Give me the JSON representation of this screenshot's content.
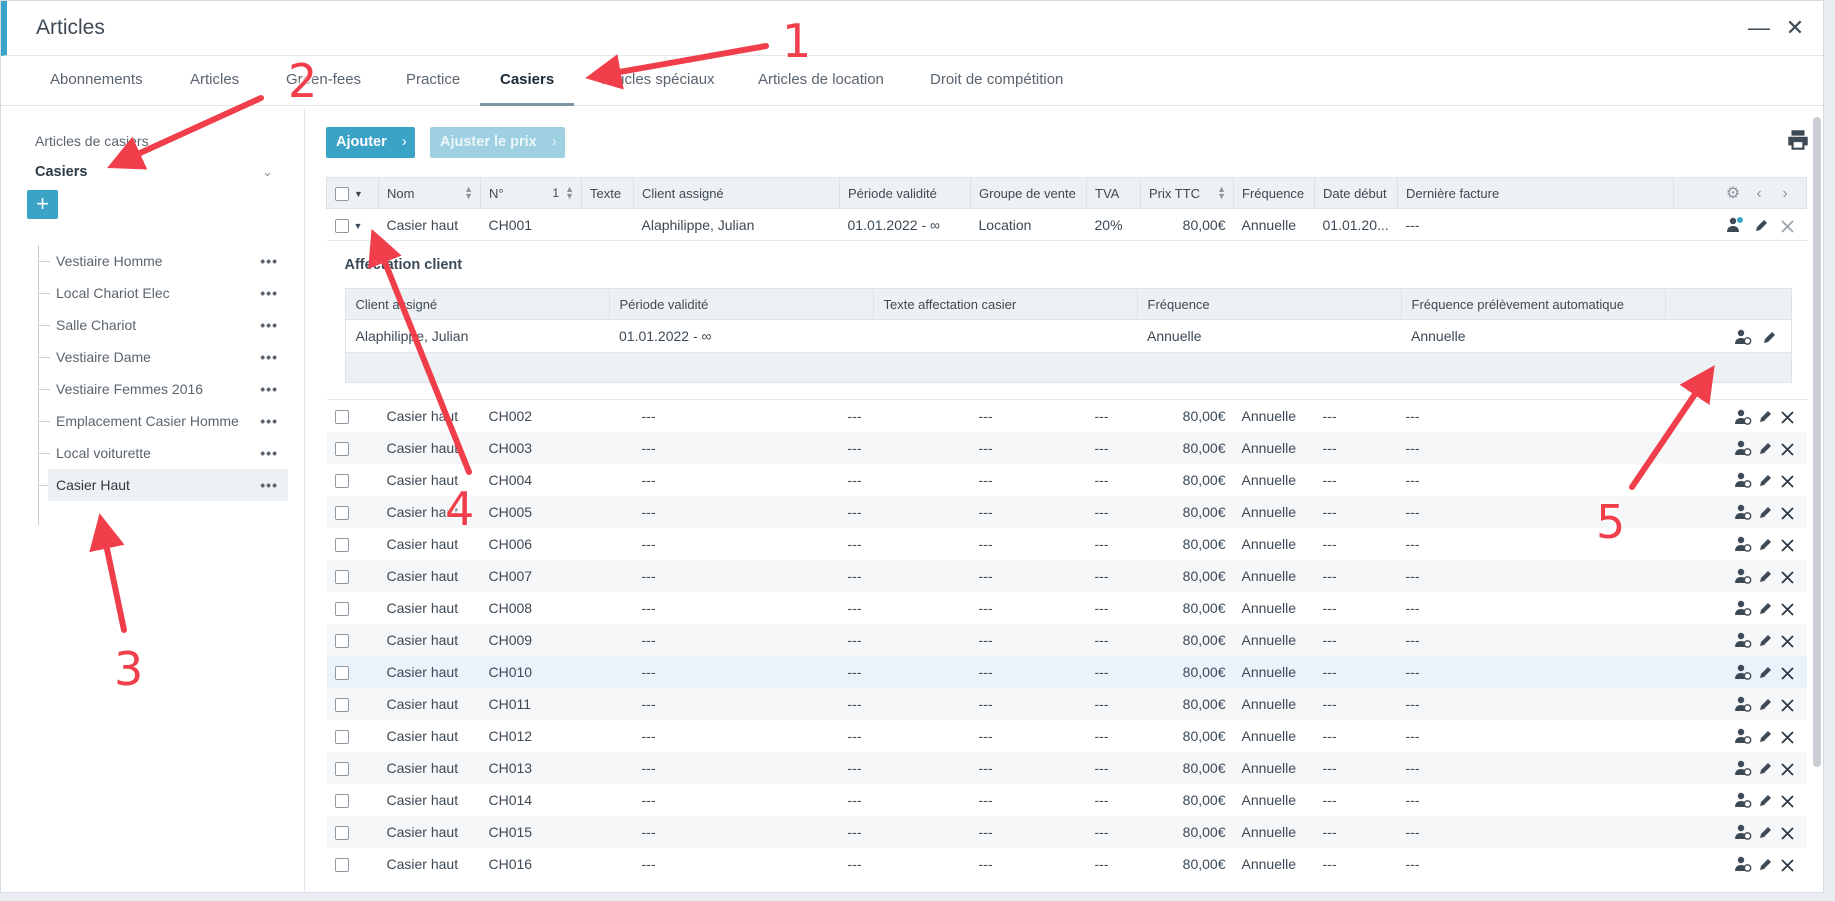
{
  "window": {
    "title": "Articles",
    "minimize_icon": "minimize-icon",
    "close_icon": "close-icon"
  },
  "tabs": [
    "Abonnements",
    "Articles",
    "Green-fees",
    "Practice",
    "Casiers",
    "Articles spéciaux",
    "Articles de location",
    "Droit de compétition"
  ],
  "active_tab": "Casiers",
  "sidebar": {
    "subtitle": "Articles de casiers",
    "heading": "Casiers",
    "add_label": "+",
    "items": [
      "Vestiaire Homme",
      "Local Chariot Elec",
      "Salle Chariot",
      "Vestiaire Dame",
      "Vestiaire Femmes 2016",
      "Emplacement Casier Homme",
      "Local voiturette",
      "Casier Haut"
    ],
    "selected": "Casier Haut",
    "more_label": "•••"
  },
  "toolbar": {
    "add_label": "Ajouter",
    "adjust_price_label": "Ajuster le prix",
    "chevron": "›"
  },
  "grid": {
    "columns": [
      "Nom",
      "N°",
      "Texte",
      "Client assigné",
      "Période validité",
      "Groupe de vente",
      "TVA",
      "Prix TTC",
      "Fréquence",
      "Date début",
      "Dernière facture"
    ],
    "sort_index": "1",
    "first_row": {
      "nom": "Casier haut",
      "no": "CH001",
      "texte": "",
      "client": "Alaphilippe, Julian",
      "periode": "01.01.2022 - ∞",
      "groupe": "Location",
      "tva": "20%",
      "prix": "80,00€",
      "frequence": "Annuelle",
      "debut": "01.01.20...",
      "derniere": "---"
    },
    "rows": [
      {
        "nom": "Casier haut",
        "no": "CH002",
        "client": "---",
        "periode": "---",
        "groupe": "---",
        "tva": "---",
        "prix": "80,00€",
        "frequence": "Annuelle",
        "debut": "---",
        "derniere": "---"
      },
      {
        "nom": "Casier haut",
        "no": "CH003",
        "client": "---",
        "periode": "---",
        "groupe": "---",
        "tva": "---",
        "prix": "80,00€",
        "frequence": "Annuelle",
        "debut": "---",
        "derniere": "---"
      },
      {
        "nom": "Casier haut",
        "no": "CH004",
        "client": "---",
        "periode": "---",
        "groupe": "---",
        "tva": "---",
        "prix": "80,00€",
        "frequence": "Annuelle",
        "debut": "---",
        "derniere": "---"
      },
      {
        "nom": "Casier haut",
        "no": "CH005",
        "client": "---",
        "periode": "---",
        "groupe": "---",
        "tva": "---",
        "prix": "80,00€",
        "frequence": "Annuelle",
        "debut": "---",
        "derniere": "---"
      },
      {
        "nom": "Casier haut",
        "no": "CH006",
        "client": "---",
        "periode": "---",
        "groupe": "---",
        "tva": "---",
        "prix": "80,00€",
        "frequence": "Annuelle",
        "debut": "---",
        "derniere": "---"
      },
      {
        "nom": "Casier haut",
        "no": "CH007",
        "client": "---",
        "periode": "---",
        "groupe": "---",
        "tva": "---",
        "prix": "80,00€",
        "frequence": "Annuelle",
        "debut": "---",
        "derniere": "---"
      },
      {
        "nom": "Casier haut",
        "no": "CH008",
        "client": "---",
        "periode": "---",
        "groupe": "---",
        "tva": "---",
        "prix": "80,00€",
        "frequence": "Annuelle",
        "debut": "---",
        "derniere": "---"
      },
      {
        "nom": "Casier haut",
        "no": "CH009",
        "client": "---",
        "periode": "---",
        "groupe": "---",
        "tva": "---",
        "prix": "80,00€",
        "frequence": "Annuelle",
        "debut": "---",
        "derniere": "---"
      },
      {
        "nom": "Casier haut",
        "no": "CH010",
        "client": "---",
        "periode": "---",
        "groupe": "---",
        "tva": "---",
        "prix": "80,00€",
        "frequence": "Annuelle",
        "debut": "---",
        "derniere": "---"
      },
      {
        "nom": "Casier haut",
        "no": "CH011",
        "client": "---",
        "periode": "---",
        "groupe": "---",
        "tva": "---",
        "prix": "80,00€",
        "frequence": "Annuelle",
        "debut": "---",
        "derniere": "---"
      },
      {
        "nom": "Casier haut",
        "no": "CH012",
        "client": "---",
        "periode": "---",
        "groupe": "---",
        "tva": "---",
        "prix": "80,00€",
        "frequence": "Annuelle",
        "debut": "---",
        "derniere": "---"
      },
      {
        "nom": "Casier haut",
        "no": "CH013",
        "client": "---",
        "periode": "---",
        "groupe": "---",
        "tva": "---",
        "prix": "80,00€",
        "frequence": "Annuelle",
        "debut": "---",
        "derniere": "---"
      },
      {
        "nom": "Casier haut",
        "no": "CH014",
        "client": "---",
        "periode": "---",
        "groupe": "---",
        "tva": "---",
        "prix": "80,00€",
        "frequence": "Annuelle",
        "debut": "---",
        "derniere": "---"
      },
      {
        "nom": "Casier haut",
        "no": "CH015",
        "client": "---",
        "periode": "---",
        "groupe": "---",
        "tva": "---",
        "prix": "80,00€",
        "frequence": "Annuelle",
        "debut": "---",
        "derniere": "---"
      },
      {
        "nom": "Casier haut",
        "no": "CH016",
        "client": "---",
        "periode": "---",
        "groupe": "---",
        "tva": "---",
        "prix": "80,00€",
        "frequence": "Annuelle",
        "debut": "---",
        "derniere": "---"
      }
    ],
    "highlighted_row": "CH010"
  },
  "detail": {
    "title": "Affectation client",
    "columns": [
      "Client assigné",
      "Période validité",
      "Texte affectation casier",
      "Fréquence",
      "Fréquence prélèvement automatique"
    ],
    "row": {
      "client": "Alaphilippe, Julian",
      "periode": "01.01.2022 - ∞",
      "texte": "",
      "frequence": "Annuelle",
      "prelevement": "Annuelle"
    }
  },
  "annotations": [
    "1",
    "2",
    "3",
    "4",
    "5"
  ],
  "colors": {
    "accent": "#3aa3c6",
    "accent_disabled": "#9fd0e2",
    "arrow": "#f03e4a",
    "header_bg": "#eef1f4",
    "row_alt": "#f5f7f9"
  }
}
